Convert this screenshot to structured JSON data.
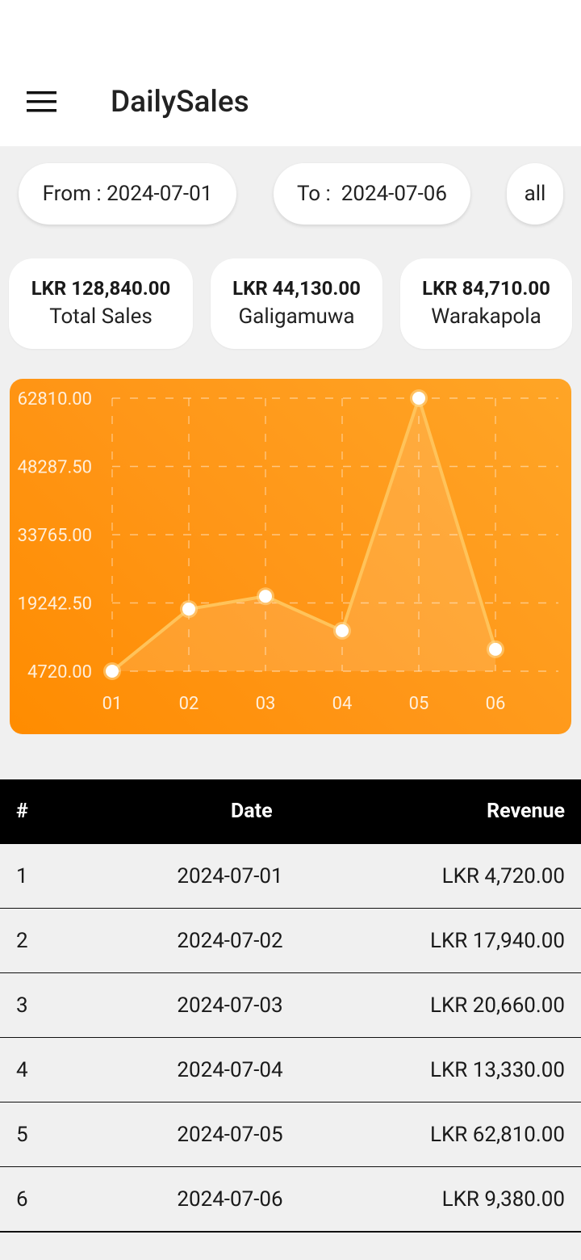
{
  "app": {
    "title": "DailySales"
  },
  "filters": {
    "from_label": "From : 2024-07-01",
    "to_label": "To :  2024-07-06",
    "scope_label": "all"
  },
  "summary": [
    {
      "amount": "LKR 128,840.00",
      "label": "Total Sales"
    },
    {
      "amount": "LKR 44,130.00",
      "label": "Galigamuwa"
    },
    {
      "amount": "LKR 84,710.00",
      "label": "Warakapola"
    }
  ],
  "chart_data": {
    "type": "line",
    "categories": [
      "01",
      "02",
      "03",
      "04",
      "05",
      "06"
    ],
    "values": [
      4720,
      17940,
      20660,
      13330,
      62810,
      9380
    ],
    "y_ticks": [
      "62810.00",
      "48287.50",
      "33765.00",
      "19242.50",
      "4720.00"
    ],
    "ylim": [
      4720,
      62810
    ],
    "grid": true,
    "title": "",
    "xlabel": "",
    "ylabel": "",
    "colors": {
      "background": "#ff9617",
      "line": "#ffc35a",
      "point": "#ffffff"
    }
  },
  "table": {
    "headers": {
      "num": "#",
      "date": "Date",
      "revenue": "Revenue"
    },
    "rows": [
      {
        "num": "1",
        "date": "2024-07-01",
        "revenue": "LKR 4,720.00"
      },
      {
        "num": "2",
        "date": "2024-07-02",
        "revenue": "LKR 17,940.00"
      },
      {
        "num": "3",
        "date": "2024-07-03",
        "revenue": "LKR 20,660.00"
      },
      {
        "num": "4",
        "date": "2024-07-04",
        "revenue": "LKR 13,330.00"
      },
      {
        "num": "5",
        "date": "2024-07-05",
        "revenue": "LKR 62,810.00"
      },
      {
        "num": "6",
        "date": "2024-07-06",
        "revenue": "LKR 9,380.00"
      }
    ]
  }
}
